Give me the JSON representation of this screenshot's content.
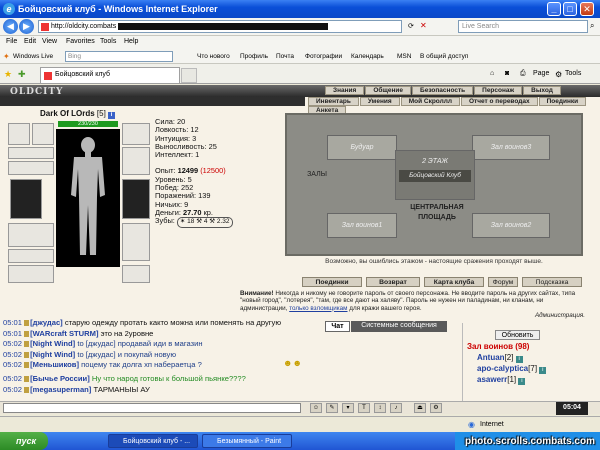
{
  "window": {
    "title": "Бойцовский клуб - Windows Internet Explorer"
  },
  "address": {
    "url": "http://oldcity.combats",
    "search_placeholder": "Live Search"
  },
  "menu": [
    "File",
    "Edit",
    "View",
    "Favorites",
    "Tools",
    "Help"
  ],
  "links_bar": {
    "windows_live": "Windows Live",
    "bing_placeholder": "Bing",
    "items": [
      "Что нового",
      "Профиль",
      "Почта",
      "Фотографии",
      "Календарь",
      "MSN",
      "В общий доступ"
    ]
  },
  "tab": {
    "title": "Бойцовский клуб",
    "page_label": "Page",
    "tools_label": "Tools"
  },
  "game": {
    "logo": "OLDCITY",
    "top_menu": [
      "Знания",
      "Общение",
      "Безопасность",
      "Персонаж",
      "Выход"
    ],
    "sub_menu": [
      "Инвентарь",
      "Умения",
      "Мой Скроллл",
      "Отчет о переводах",
      "Поединки",
      "Анкета"
    ],
    "character": {
      "name": "Dark Of LOrds",
      "level": "[5]",
      "badge": "i",
      "hp": "230/230"
    },
    "stats": [
      {
        "label": "Сила:",
        "value": "20"
      },
      {
        "label": "Ловкость:",
        "value": "12"
      },
      {
        "label": "Интуиция:",
        "value": "3"
      },
      {
        "label": "Выносливость:",
        "value": "25"
      },
      {
        "label": "Интеллект:",
        "value": "1"
      }
    ],
    "exp": {
      "label": "Опыт:",
      "value": "12499",
      "next": "(12500)"
    },
    "stats2": [
      {
        "label": "Уровень:",
        "value": "5"
      },
      {
        "label": "Побед:",
        "value": "252"
      },
      {
        "label": "Поражений:",
        "value": "139"
      },
      {
        "label": "Ничьих:",
        "value": "9"
      }
    ],
    "money": {
      "label": "Деньги:",
      "value": "27.70",
      "unit": "кр."
    },
    "teeth": {
      "label": "Зубы:",
      "value": "✶ 18 ⚒ 4 ⚒ 2.32"
    },
    "map": {
      "rooms": [
        "Будуар",
        "Зал воинов3",
        "2 ЭТАЖ",
        "Бойцовский Клуб",
        "ЗАЛЫ",
        "ЦЕНТРАЛЬНАЯ ПЛОЩАДЬ",
        "Зал воинов1",
        "Зал воинов2"
      ],
      "caption": "Возможно, вы ошиблись этажом - настоящие сражения проходят выше."
    },
    "buttons": [
      "Поединки",
      "Возврат",
      "Карта клуба",
      "Форум",
      "Подсказка"
    ],
    "warning": {
      "label": "Внимание!",
      "text": "Никогда и никому не говорите пароль от своего персонажа. Не вводите пароль на других сайтах, типа \"новый город\", \"лотерея\", \"там, где все дают на халяву\". Пароль не нужен ни паладинам, ни кланам, ни администрации,",
      "link": "только взломщикам",
      "text2": "для кражи вашего героя.",
      "signature": "Администрация."
    }
  },
  "chat": {
    "tabs": [
      "Чат",
      "Системные сообщения"
    ],
    "lines": [
      {
        "time": "05:01",
        "nick": "[джудас]",
        "msg": "старую одежду протать както можна или поменять на другую"
      },
      {
        "time": "05:01",
        "nick": "[WARcraft STURM]",
        "msg": "это на 2уровне"
      },
      {
        "time": "05:02",
        "nick": "[Night Wind]",
        "msg": "to [джудас] продавай иди в магазин"
      },
      {
        "time": "05:02",
        "nick": "[Night Wind]",
        "msg": "to [джудас] и покупай новую"
      },
      {
        "time": "05:02",
        "nick": "[Меньшиков]",
        "msg": "поцему так долга хп набераетца ?"
      },
      {
        "time": "05:02",
        "nick": "[Бычье России]",
        "msg": "Ну что народ готовы к большой пьянке????"
      },
      {
        "time": "05:02",
        "nick": "[megasuperman]",
        "msg": "ТАРМАНЫЫ АУ"
      }
    ]
  },
  "users": {
    "refresh_label": "Обновить",
    "room_title": "Зал воинов (98)",
    "list": [
      {
        "name": "Antuan",
        "level": "[2]"
      },
      {
        "name": "apo-calyptica",
        "level": "[7]"
      },
      {
        "name": "asawerr",
        "level": "[1]"
      }
    ]
  },
  "clock": "05:04",
  "status": {
    "zone": "Internet"
  },
  "taskbar": {
    "start": "пуск",
    "items": [
      "Бойцовский клуб - ...",
      "Безымянный - Paint"
    ],
    "watermark": "photo.scrolls.combats.com"
  }
}
